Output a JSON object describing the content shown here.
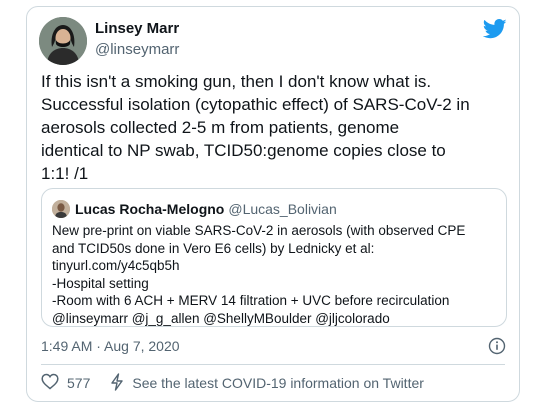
{
  "tweet": {
    "author": {
      "name": "Linsey Marr",
      "handle": "@linseymarr"
    },
    "text_lines": [
      "If this isn't a smoking gun, then I don't know what is.",
      "Successful isolation (cytopathic effect) of SARS-CoV-2 in",
      "aerosols collected 2-5 m from patients, genome",
      "identical to NP swab, TCID50:genome copies close to",
      "1:1! /1"
    ],
    "quoted": {
      "author": {
        "name": "Lucas Rocha-Melogno",
        "handle": "@Lucas_Bolivian"
      },
      "text_lines": [
        "New pre-print on viable SARS-CoV-2 in aerosols (with observed CPE",
        "and TCID50s done in Vero E6 cells) by Lednicky et al:",
        "tinyurl.com/y4c5qb5h",
        "-Hospital setting",
        "-Room with 6 ACH + MERV 14 filtration + UVC before recirculation",
        "@linseymarr @j_g_allen @ShellyMBoulder @jljcolorado"
      ]
    },
    "timestamp": "1:49 AM · Aug 7, 2020",
    "likes": "577",
    "covid_info": "See the latest COVID-19 information on Twitter"
  },
  "colors": {
    "brand": "#1d9bf0",
    "text": "#0f1419",
    "secondary": "#536471",
    "border": "#cfd9de"
  },
  "icons": [
    "avatar",
    "twitter-bird-icon",
    "info-icon",
    "heart-icon",
    "lightning-icon"
  ]
}
